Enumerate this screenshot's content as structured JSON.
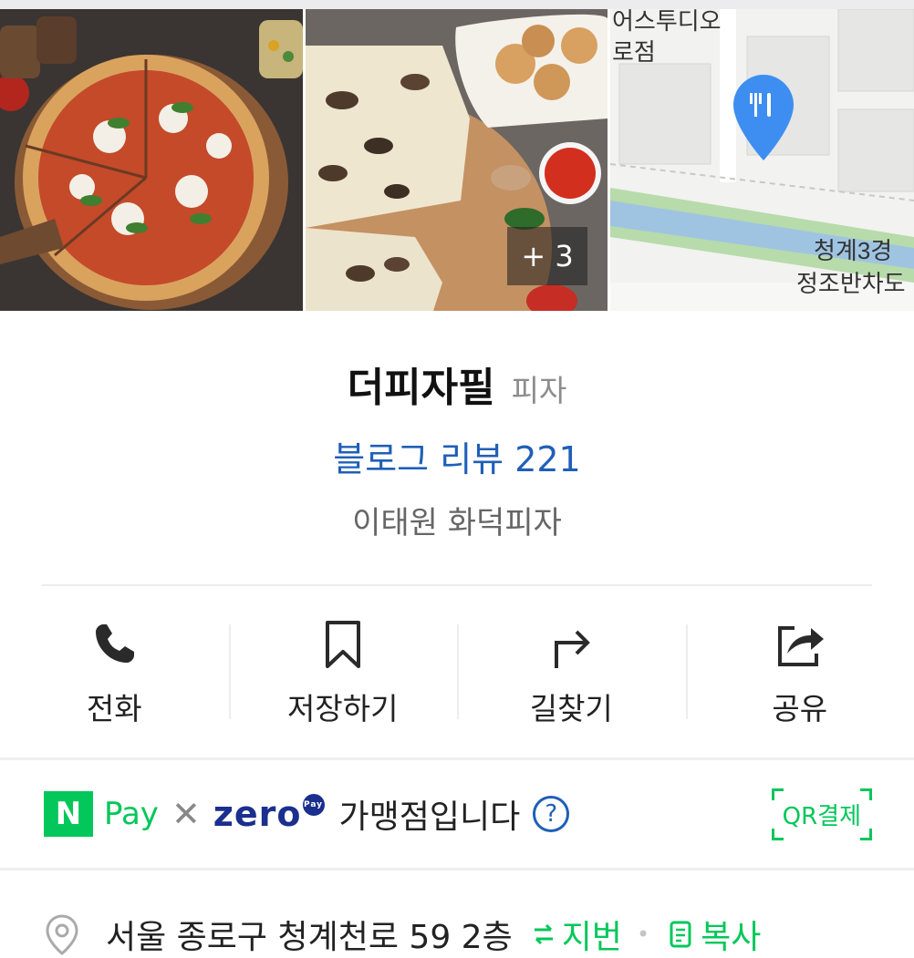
{
  "photos": {
    "more_count": "+ 3"
  },
  "map": {
    "label_top_1": "어스투디오",
    "label_top_2": "로점",
    "label_bottom_1": "청계3경",
    "label_bottom_2": "정조반차도"
  },
  "place": {
    "name": "더피자필",
    "category": "피자",
    "blog_review": "블로그 리뷰 221",
    "description": "이태원 화덕피자"
  },
  "actions": [
    {
      "label": "전화",
      "icon": "phone-icon"
    },
    {
      "label": "저장하기",
      "icon": "bookmark-icon"
    },
    {
      "label": "길찾기",
      "icon": "directions-icon"
    },
    {
      "label": "공유",
      "icon": "share-icon"
    }
  ],
  "pay": {
    "npay_logo": "N",
    "npay_text": "Pay",
    "times": "✕",
    "zero_text": "zero",
    "zero_badge": "Pay",
    "message": "가맹점입니다",
    "help": "?",
    "qr_label": "QR결제"
  },
  "address": {
    "text": "서울 종로구 청계천로 59 2층",
    "jibun_label": "지번",
    "copy_label": "복사"
  },
  "colors": {
    "accent_blue": "#1f5fb8",
    "naver_green": "#03c75a",
    "zero_navy": "#1a2f8f"
  }
}
